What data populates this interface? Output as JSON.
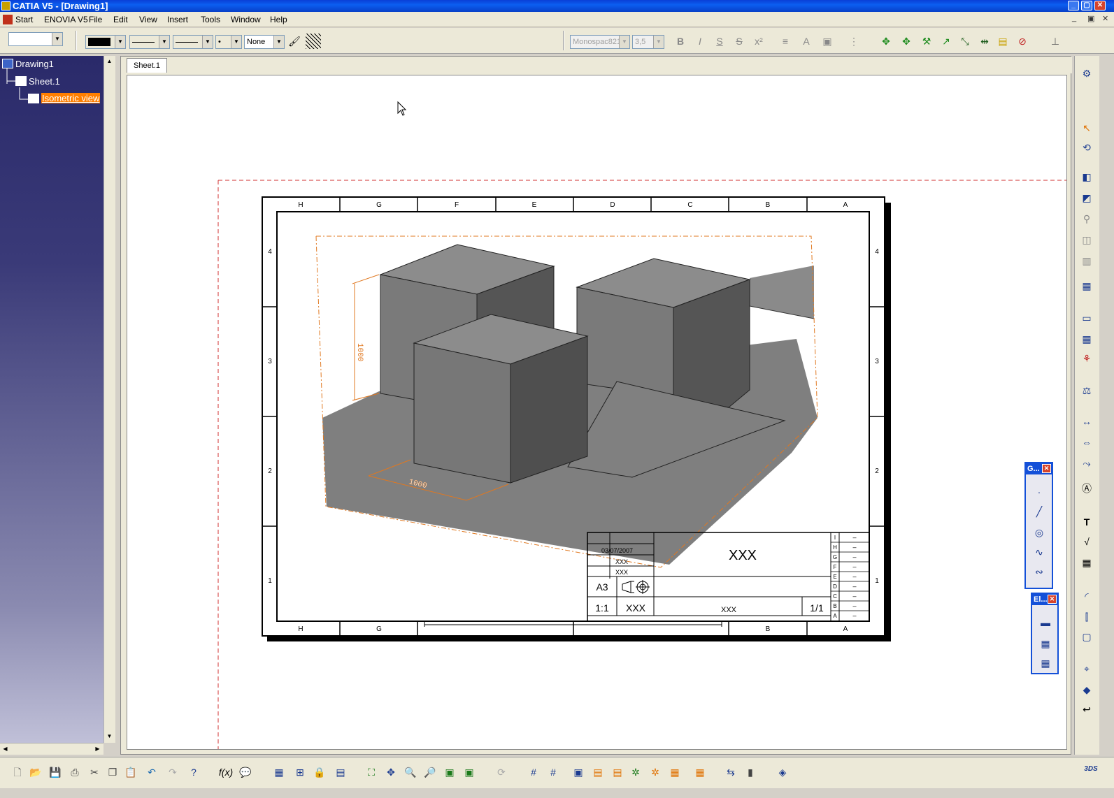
{
  "window": {
    "title": "CATIA V5 - [Drawing1]"
  },
  "menu": [
    "Start",
    "ENOVIA V5",
    "File",
    "Edit",
    "View",
    "Insert",
    "Tools",
    "Window",
    "Help"
  ],
  "toolbar": {
    "linetype_value": "None",
    "font_value": "Monospac821",
    "font_size_value": "3,5"
  },
  "tree": {
    "root": "Drawing1",
    "sheet": "Sheet.1",
    "view": "Isometric view"
  },
  "tabs": {
    "sheet_tab": "Sheet.1"
  },
  "frame": {
    "columns": [
      "H",
      "G",
      "F",
      "E",
      "D",
      "C",
      "B",
      "A"
    ],
    "bottom_columns": [
      "H",
      "G",
      "B",
      "A"
    ],
    "rows": [
      "4",
      "3",
      "2",
      "1"
    ]
  },
  "dimensions": {
    "vertical": "1000",
    "horizontal": "1000"
  },
  "titleblock": {
    "date": "03/07/2007",
    "checked": "XXX",
    "approved": "XXX",
    "title": "XXX",
    "format": "A3",
    "scale": "1:1",
    "weight": "XXX",
    "drawing_number": "XXX",
    "sheet": "1/1",
    "revisions": [
      "I",
      "H",
      "G",
      "F",
      "E",
      "D",
      "C",
      "B",
      "A"
    ],
    "revision_values": [
      "–",
      "–",
      "–",
      "–",
      "–",
      "–",
      "–",
      "–",
      "–"
    ]
  },
  "palettes": {
    "geometry": "G...",
    "elements": "El..."
  },
  "colors": {
    "titlebar": "#0b5ef0",
    "tree_bg": "#3a3a78",
    "highlight": "#ff7f00",
    "dimension": "#e07820",
    "solid_gray": "#808080"
  }
}
